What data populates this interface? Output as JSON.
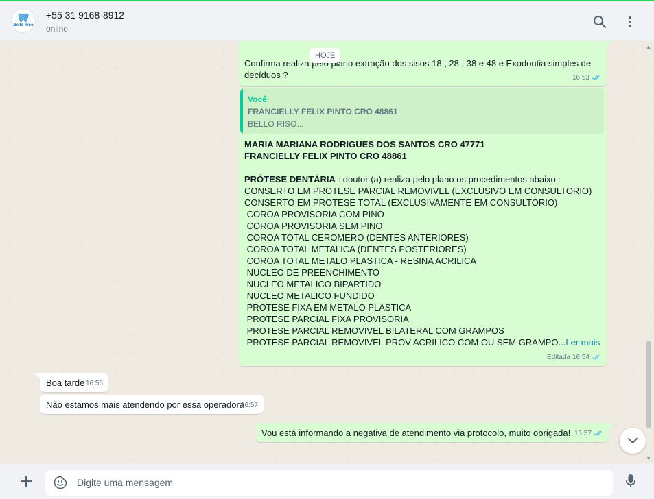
{
  "header": {
    "avatar_text": "Bello Riso",
    "contact_name": "+55 31 9168-8912",
    "status": "online",
    "icons": [
      "search-icon",
      "menu-icon"
    ]
  },
  "chat": {
    "date_chip": "HOJE",
    "messages": [
      {
        "direction": "outgoing",
        "text": "Confirma realiza pelo plano  extração dos sisos 18 , 28 , 38 e 48 e Exodontia simples de decíduos ?",
        "time": "16:53",
        "status": "read"
      },
      {
        "direction": "outgoing",
        "quote": {
          "author": "Você",
          "title": "FRANCIELLY FELIX PINTO CRO 48861",
          "subtitle": "BELLO RISO..."
        },
        "lines_bold": [
          "MARIA MARIANA RODRIGUES DOS SANTOS CRO 47771",
          "FRANCIELLY FELIX PINTO CRO 48861"
        ],
        "section_title": "PRÓTESE DENTÁRIA",
        "section_intro": " : doutor (a) realiza pelo plano os procedimentos abaixo :",
        "items": [
          "CONSERTO EM PROTESE PARCIAL REMOVIVEL (EXCLUSIVO EM CONSULTORIO)",
          "CONSERTO EM PROTESE TOTAL (EXCLUSIVAMENTE EM CONSULTORIO)",
          " COROA PROVISORIA COM PINO",
          " COROA PROVISORIA SEM PINO",
          " COROA TOTAL CEROMERO (DENTES ANTERIORES)",
          " COROA TOTAL METALICA (DENTES POSTERIORES)",
          " COROA TOTAL METALO PLASTICA - RESINA ACRILICA",
          " NUCLEO DE PREENCHIMENTO",
          " NUCLEO METALICO BIPARTIDO",
          " NUCLEO METALICO FUNDIDO",
          " PROTESE FIXA EM METALO PLASTICA",
          " PROTESE PARCIAL FIXA PROVISORIA",
          " PROTESE PARCIAL REMOVIVEL BILATERAL COM GRAMPOS",
          " PROTESE PARCIAL REMOVIVEL PROV ACRILICO COM OU SEM GRAMPO..."
        ],
        "read_more": "Ler mais",
        "edited_label": "Editada",
        "time": "16:54",
        "status": "read"
      },
      {
        "direction": "incoming",
        "text": "Boa tarde",
        "time": "16:56"
      },
      {
        "direction": "incoming",
        "text": "Não estamos mais atendendo por essa operadora",
        "time": "16:57"
      },
      {
        "direction": "outgoing",
        "text": "Vou está informando a negativa de atendimento via protocolo, muito obrigada!",
        "time": "16:57",
        "status": "read"
      }
    ]
  },
  "composer": {
    "placeholder": "Digite uma mensagem",
    "value": "",
    "icons": [
      "plus-icon",
      "sticker-icon",
      "microphone-icon"
    ]
  },
  "colors": {
    "outgoing_bubble": "#d9fdd3",
    "incoming_bubble": "#ffffff",
    "accent": "#25d366",
    "read_ticks": "#53bdeb",
    "link": "#027eb5"
  }
}
